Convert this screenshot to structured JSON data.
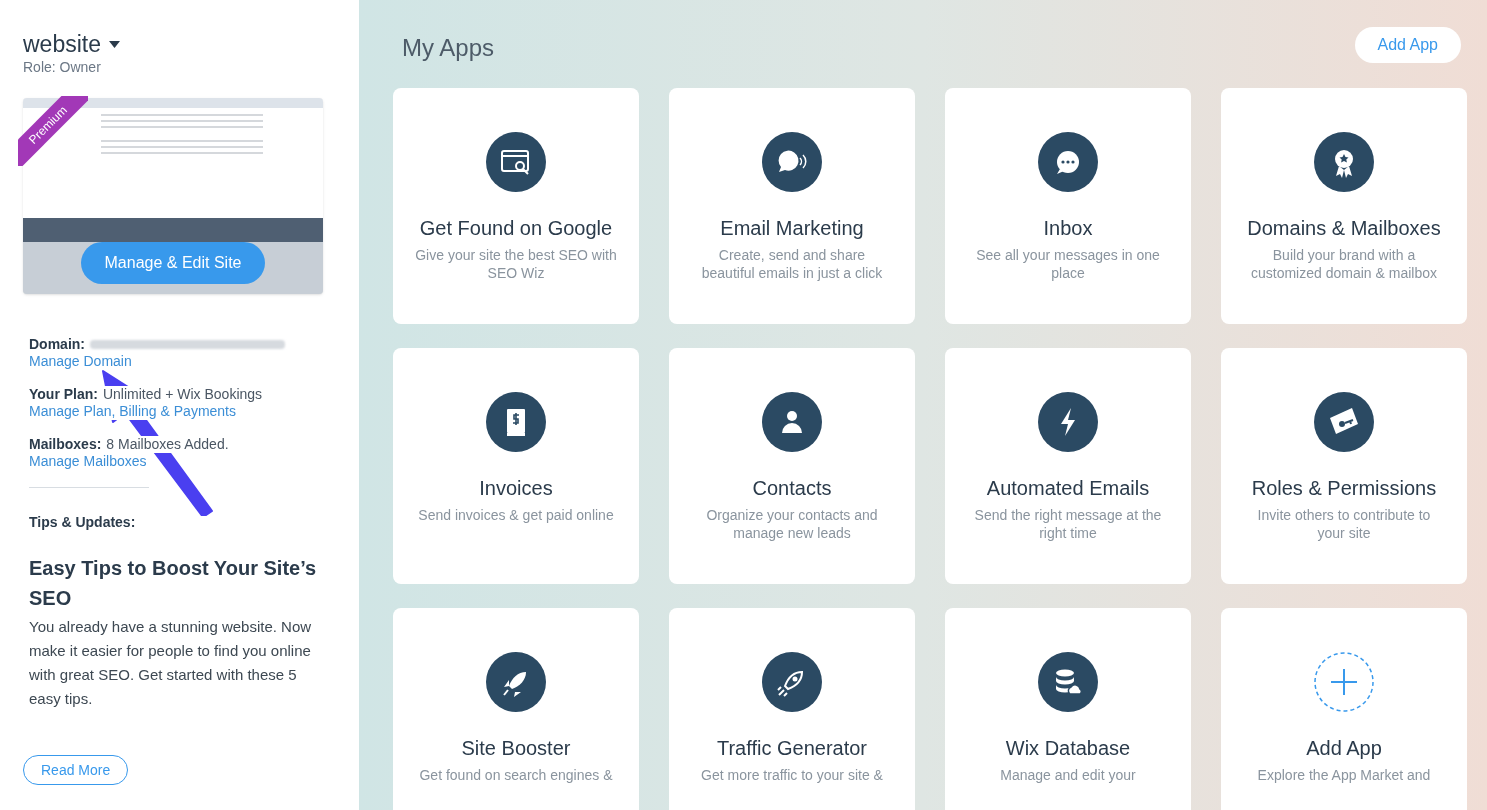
{
  "sidebar": {
    "site_name": "website",
    "role": "Role: Owner",
    "preview": {
      "ribbon": "Premium",
      "button": "Manage & Edit Site"
    },
    "details": [
      {
        "label": "Domain:",
        "value_blurred": true,
        "link": "Manage Domain"
      },
      {
        "label": "Your Plan:",
        "value": "Unlimited + Wix Bookings",
        "link": "Manage Plan, Billing & Payments"
      },
      {
        "label": "Mailboxes:",
        "value": "8 Mailboxes Added.",
        "link": "Manage Mailboxes"
      }
    ],
    "tips": {
      "heading": "Tips & Updates:",
      "title": "Easy Tips to Boost Your Site’s SEO",
      "body": "You already have a stunning website. Now make it easier for people to find you online with great SEO. Get started with these 5 easy tips.",
      "button": "Read More"
    }
  },
  "main": {
    "title": "My Apps",
    "add_button": "Add App",
    "apps": [
      {
        "kind": "app",
        "title": "Get Found on Google",
        "description": "Give your site the best SEO with SEO Wiz"
      },
      {
        "kind": "app",
        "title": "Email Marketing",
        "description": "Create, send and share beautiful emails in just a click"
      },
      {
        "kind": "app",
        "title": "Inbox",
        "description": "See all your messages in one place"
      },
      {
        "kind": "app",
        "title": "Domains & Mailboxes",
        "description": "Build your brand with a customized domain & mailbox"
      },
      {
        "kind": "app",
        "title": "Invoices",
        "description": "Send invoices & get paid online"
      },
      {
        "kind": "app",
        "title": "Contacts",
        "description": "Organize your contacts and manage new leads"
      },
      {
        "kind": "app",
        "title": "Automated Emails",
        "description": "Send the right message at the right time"
      },
      {
        "kind": "app",
        "title": "Roles & Permissions",
        "description": "Invite others to contribute to your site"
      },
      {
        "kind": "app",
        "title": "Site Booster",
        "description": "Get found on search engines &"
      },
      {
        "kind": "app",
        "title": "Traffic Generator",
        "description": "Get more traffic to your site &"
      },
      {
        "kind": "app",
        "title": "Wix Database",
        "description": "Manage and edit your"
      },
      {
        "kind": "add",
        "title": "Add App",
        "description": "Explore the App Market and"
      }
    ]
  }
}
